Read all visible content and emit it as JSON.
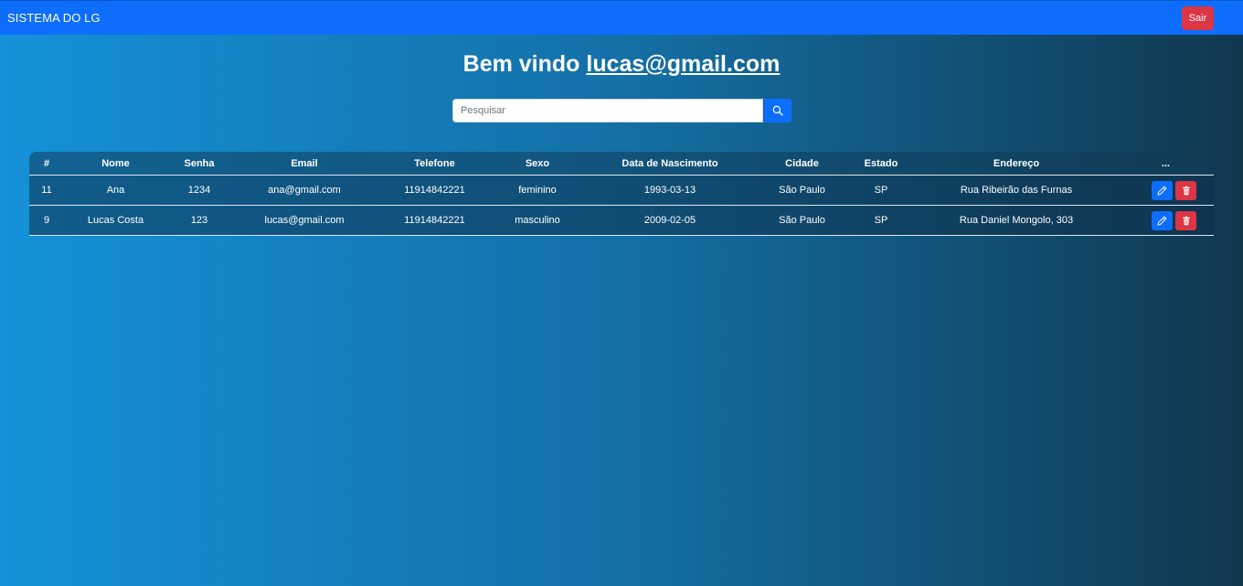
{
  "navbar": {
    "brand": "SISTEMA DO LG",
    "logout_label": "Sair"
  },
  "welcome": {
    "prefix": "Bem vindo ",
    "email": "lucas@gmail.com"
  },
  "search": {
    "placeholder": "Pesquisar",
    "value": "",
    "icon": "search-icon"
  },
  "table": {
    "columns": [
      "#",
      "Nome",
      "Senha",
      "Email",
      "Telefone",
      "Sexo",
      "Data de Nascimento",
      "Cidade",
      "Estado",
      "Endereço",
      "..."
    ],
    "rows": [
      {
        "id": "11",
        "nome": "Ana",
        "senha": "1234",
        "email": "ana@gmail.com",
        "telefone": "11914842221",
        "sexo": "feminino",
        "nascimento": "1993-03-13",
        "cidade": "São Paulo",
        "estado": "SP",
        "endereco": "Rua Ribeirão das Furnas"
      },
      {
        "id": "9",
        "nome": "Lucas Costa",
        "senha": "123",
        "email": "lucas@gmail.com",
        "telefone": "11914842221",
        "sexo": "masculino",
        "nascimento": "2009-02-05",
        "cidade": "São Paulo",
        "estado": "SP",
        "endereco": "Rua Daniel Mongolo, 303"
      }
    ],
    "row_actions": [
      "pencil-icon",
      "trash-icon"
    ]
  },
  "colors": {
    "primary": "#0d6efd",
    "danger": "#dc3545",
    "gradient_start": "#1591d9",
    "gradient_end": "#10384f"
  }
}
